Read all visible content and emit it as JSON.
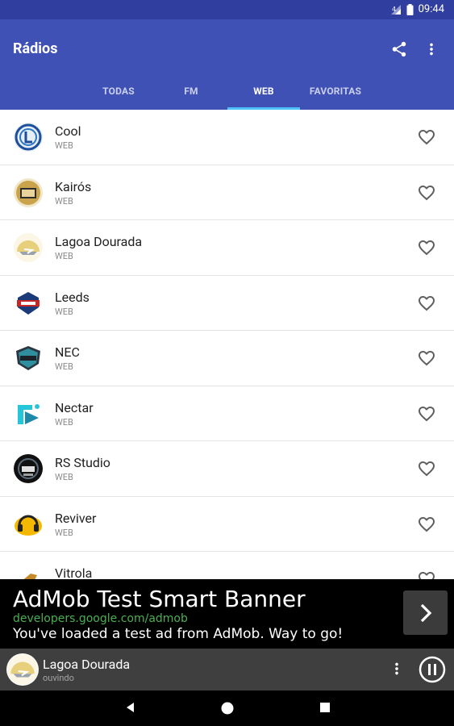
{
  "status": {
    "time": "09:44"
  },
  "appbar": {
    "title": "Rádios",
    "share_icon": "share-icon",
    "more_icon": "more-vert-icon"
  },
  "tabs": [
    {
      "label": "TODAS",
      "active": false
    },
    {
      "label": "FM",
      "active": false
    },
    {
      "label": "WEB",
      "active": true
    },
    {
      "label": "FAVORITAS",
      "active": false
    }
  ],
  "stations": [
    {
      "name": "Cool",
      "type": "WEB"
    },
    {
      "name": "Kairós",
      "type": "WEB"
    },
    {
      "name": "Lagoa Dourada",
      "type": "WEB"
    },
    {
      "name": "Leeds",
      "type": "WEB"
    },
    {
      "name": "NEC",
      "type": "WEB"
    },
    {
      "name": "Nectar",
      "type": "WEB"
    },
    {
      "name": "RS Studio",
      "type": "WEB"
    },
    {
      "name": "Reviver",
      "type": "WEB"
    },
    {
      "name": "Vitrola",
      "type": "WEB"
    }
  ],
  "ad": {
    "headline": "AdMob Test Smart Banner",
    "url": "developers.google.com/admob",
    "description": "You've loaded a test ad from AdMob. Way to go!"
  },
  "player": {
    "station": "Lagoa Dourada",
    "status": "ouvindo"
  },
  "colors": {
    "primary": "#3F51B5",
    "primary_dark": "#303F9F",
    "tab_indicator": "#4FC3F7",
    "ad_url": "#4CAF50"
  }
}
